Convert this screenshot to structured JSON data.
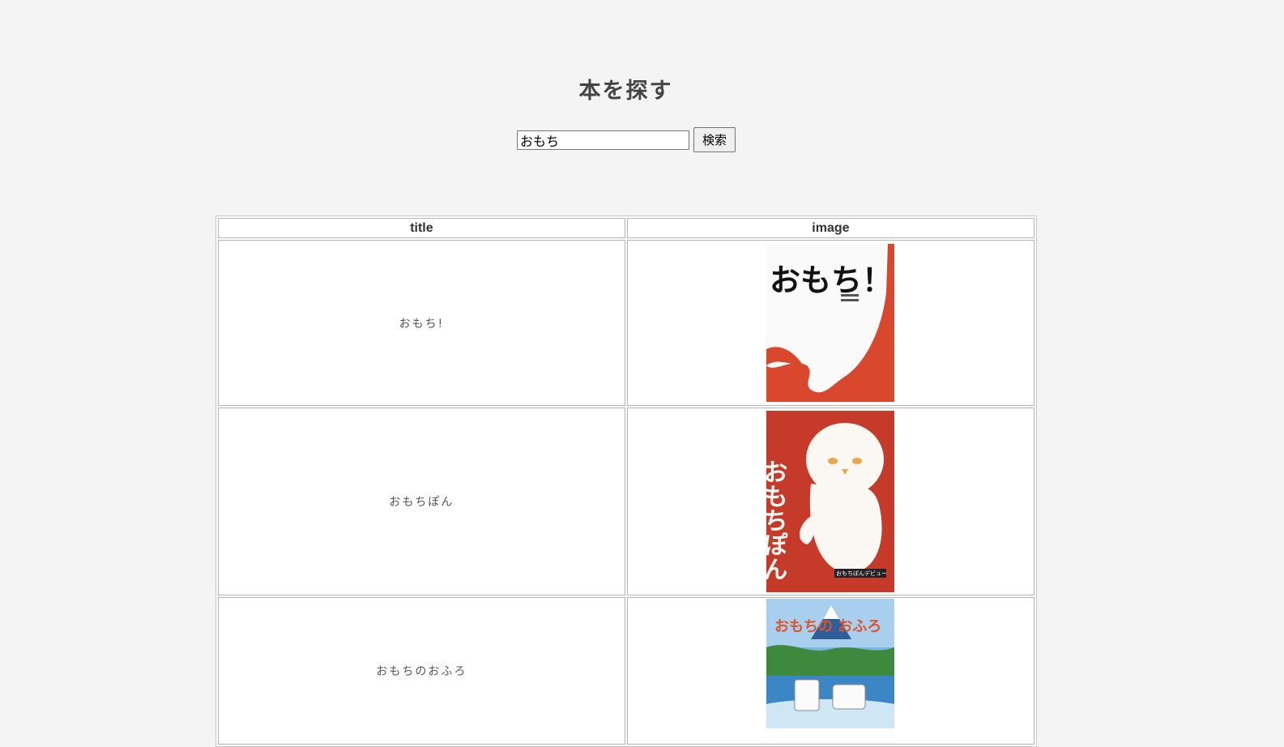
{
  "page": {
    "heading": "本を探す"
  },
  "search": {
    "value": "おもち",
    "button_label": "検索"
  },
  "table": {
    "headers": [
      "title",
      "image"
    ],
    "rows": [
      {
        "title": "おもち!",
        "cover_text": "おもち！"
      },
      {
        "title": "おもちぽん",
        "cover_text": "おもちぽん",
        "cover_badge": "おもちぽんデビュー"
      },
      {
        "title": "おもちのおふろ",
        "cover_text": "おもちの おふろ"
      }
    ]
  },
  "colors": {
    "background": "#f4f4f4",
    "cover1_red": "#d9472c",
    "cover2_red": "#c63a2a",
    "cover3_sky": "#3b86c4"
  }
}
